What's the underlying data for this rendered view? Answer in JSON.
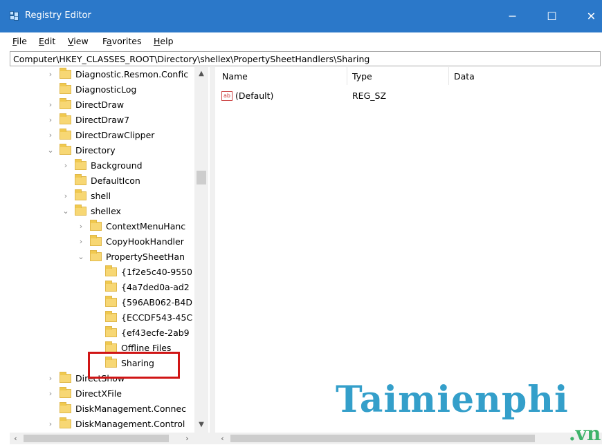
{
  "window": {
    "title": "Registry Editor",
    "minimize": "─",
    "maximize": "☐",
    "close": "✕"
  },
  "menu": [
    {
      "underline": "F",
      "rest": "ile"
    },
    {
      "underline": "E",
      "rest": "dit"
    },
    {
      "underline": "V",
      "rest": "iew"
    },
    {
      "pre": "F",
      "underline": "a",
      "rest": "vorites"
    },
    {
      "underline": "H",
      "rest": "elp"
    }
  ],
  "address": "Computer\\HKEY_CLASSES_ROOT\\Directory\\shellex\\PropertySheetHandlers\\Sharing",
  "tree": [
    {
      "label": "Diagnostic.Resmon.Confic",
      "expander": "›"
    },
    {
      "label": "DiagnosticLog",
      "expander": ""
    },
    {
      "label": "DirectDraw",
      "expander": "›"
    },
    {
      "label": "DirectDraw7",
      "expander": "›"
    },
    {
      "label": "DirectDrawClipper",
      "expander": "›"
    },
    {
      "label": "Directory",
      "expander": "⌄"
    },
    {
      "label": "Background",
      "expander": "›"
    },
    {
      "label": "DefaultIcon",
      "expander": ""
    },
    {
      "label": "shell",
      "expander": "›"
    },
    {
      "label": "shellex",
      "expander": "⌄"
    },
    {
      "label": "ContextMenuHanc",
      "expander": "›"
    },
    {
      "label": "CopyHookHandler",
      "expander": "›"
    },
    {
      "label": "PropertySheetHan",
      "expander": "⌄"
    },
    {
      "label": "{1f2e5c40-9550",
      "expander": ""
    },
    {
      "label": "{4a7ded0a-ad2",
      "expander": ""
    },
    {
      "label": "{596AB062-B4D",
      "expander": ""
    },
    {
      "label": "{ECCDF543-45C",
      "expander": ""
    },
    {
      "label": "{ef43ecfe-2ab9",
      "expander": ""
    },
    {
      "label": "Offline Files",
      "expander": ""
    },
    {
      "label": "Sharing",
      "expander": ""
    },
    {
      "label": "DirectShow",
      "expander": "›"
    },
    {
      "label": "DirectXFile",
      "expander": "›"
    },
    {
      "label": "DiskManagement.Connec",
      "expander": ""
    },
    {
      "label": "DiskManagement.Control",
      "expander": "›"
    }
  ],
  "list": {
    "columns": [
      "Name",
      "Type",
      "Data"
    ],
    "rows": [
      {
        "icon": "ab",
        "name": "(Default)",
        "type": "REG_SZ",
        "data": ""
      }
    ]
  },
  "watermark": {
    "main": "Taimienphi",
    "sub": ".vn"
  },
  "colors": {
    "titlebar": "#2b78c9",
    "highlight": "#d01515",
    "watermark": "#2a9ac8"
  }
}
